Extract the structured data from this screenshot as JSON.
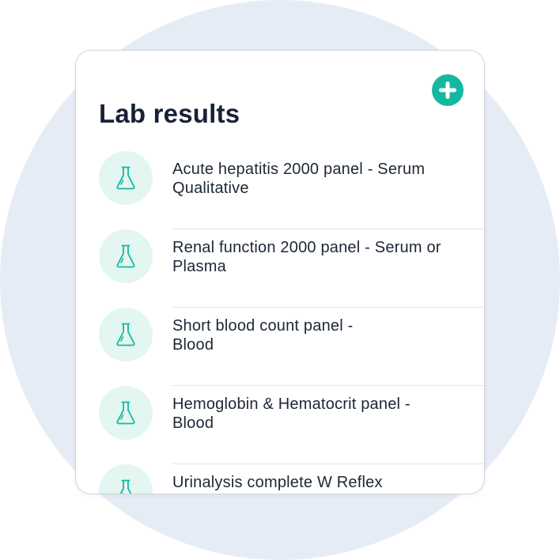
{
  "card": {
    "title": "Lab results",
    "add_button_icon": "plus-circle-icon"
  },
  "lab_results": {
    "items": [
      {
        "label": "Acute hepatitis 2000 panel - Serum Qualitative",
        "icon": "flask-icon"
      },
      {
        "label": "Renal function 2000 panel - Serum or Plasma",
        "icon": "flask-icon"
      },
      {
        "label": "Short blood count panel - Blood",
        "icon": "flask-icon"
      },
      {
        "label": "Hemoglobin & Hematocrit panel - Blood",
        "icon": "flask-icon"
      },
      {
        "label": "Urinalysis complete W Reflex",
        "icon": "flask-icon"
      }
    ]
  },
  "colors": {
    "accent": "#14b8a0",
    "icon_background": "#e3f6f1",
    "page_circle": "#e6ecf5",
    "title_text": "#172235",
    "item_text": "#1d2736",
    "divider": "#e1e5eb"
  }
}
